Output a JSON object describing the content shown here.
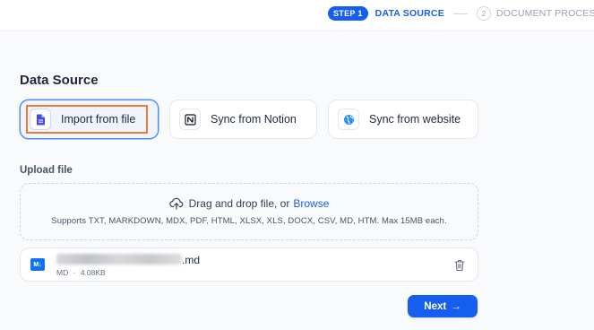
{
  "stepper": {
    "step1_badge": "STEP 1",
    "step1_label": "DATA SOURCE",
    "step2_number": "2",
    "step2_label": "DOCUMENT PROCESSING"
  },
  "section_title": "Data Source",
  "sources": [
    {
      "label": "Import from file",
      "icon": "file-icon",
      "selected": true
    },
    {
      "label": "Sync from Notion",
      "icon": "notion-icon",
      "selected": false
    },
    {
      "label": "Sync from website",
      "icon": "globe-icon",
      "selected": false
    }
  ],
  "upload": {
    "title": "Upload file",
    "drop_text": "Drag and drop file, or",
    "browse_label": "Browse",
    "supports_text": "Supports TXT, MARKDOWN, MDX, PDF, HTML, XLSX, XLS, DOCX, CSV, MD, HTM. Max 15MB each."
  },
  "file": {
    "icon_text": "M↓",
    "name_suffix": ".md",
    "type": "MD",
    "size": "4.08KB"
  },
  "actions": {
    "next_label": "Next",
    "next_arrow": "→"
  },
  "colors": {
    "primary": "#155eef",
    "highlight": "#ef7a34"
  }
}
